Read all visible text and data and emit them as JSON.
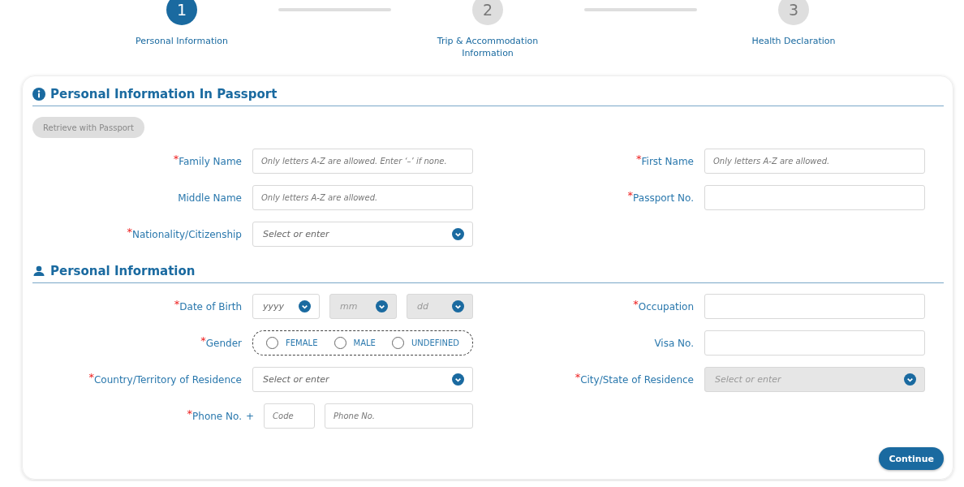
{
  "steps": [
    {
      "number": "1",
      "label": "Personal Information",
      "selected": true
    },
    {
      "number": "2",
      "label": "Trip & Accommodation Information",
      "selected": false
    },
    {
      "number": "3",
      "label": "Health Declaration",
      "selected": false
    }
  ],
  "sections": [
    {
      "title": "Personal Information In Passport",
      "kind": "info",
      "button": "Retrieve with Passport",
      "rows": [
        {
          "left": {
            "label": "Family Name",
            "required_mark": "*",
            "kind": "text",
            "placeholder": "Only letters A-Z are allowed. Enter ‘–’ if none."
          },
          "right": {
            "label": "First Name",
            "required_mark": "*",
            "kind": "text",
            "placeholder": "Only letters A-Z are allowed."
          }
        },
        {
          "left": {
            "label": "Middle Name",
            "kind": "text",
            "placeholder": "Only letters A-Z are allowed."
          },
          "right": {
            "label": "Passport No.",
            "required_mark": "*",
            "kind": "text"
          }
        },
        {
          "left": {
            "label": "Nationality/Citizenship",
            "required_mark": "*",
            "kind": "select",
            "placeholder": "Select or enter",
            "disabled": false
          }
        }
      ]
    },
    {
      "title": "Personal Information",
      "kind": "person",
      "rows": [
        {
          "left": {
            "label": "Date of Birth",
            "required_mark": "*",
            "kind": "date",
            "parts": [
              {
                "placeholder": "yyyy",
                "disabled": false
              },
              {
                "placeholder": "mm",
                "disabled": true
              },
              {
                "placeholder": "dd",
                "disabled": true
              }
            ]
          },
          "right": {
            "label": "Occupation",
            "required_mark": "*",
            "kind": "text"
          }
        },
        {
          "left": {
            "label": "Gender",
            "required_mark": "*",
            "kind": "radio",
            "options": [
              {
                "label": "FEMALE",
                "selected": false
              },
              {
                "label": "MALE",
                "selected": false
              },
              {
                "label": "UNDEFINED",
                "selected": false
              }
            ]
          },
          "right": {
            "label": "Visa No.",
            "kind": "text"
          }
        },
        {
          "left": {
            "label": "Country/Territory of Residence",
            "required_mark": "*",
            "kind": "select",
            "placeholder": "Select or enter",
            "disabled": false
          },
          "right": {
            "label": "City/State of Residence",
            "required_mark": "*",
            "kind": "select",
            "placeholder": "Select or enter",
            "disabled": true
          }
        },
        {
          "left": {
            "label": "Phone No.",
            "required_mark": "*",
            "kind": "phone",
            "prefix": "+",
            "code_placeholder": "Code",
            "placeholder": "Phone No."
          }
        }
      ]
    }
  ],
  "continue_button": "Continue"
}
